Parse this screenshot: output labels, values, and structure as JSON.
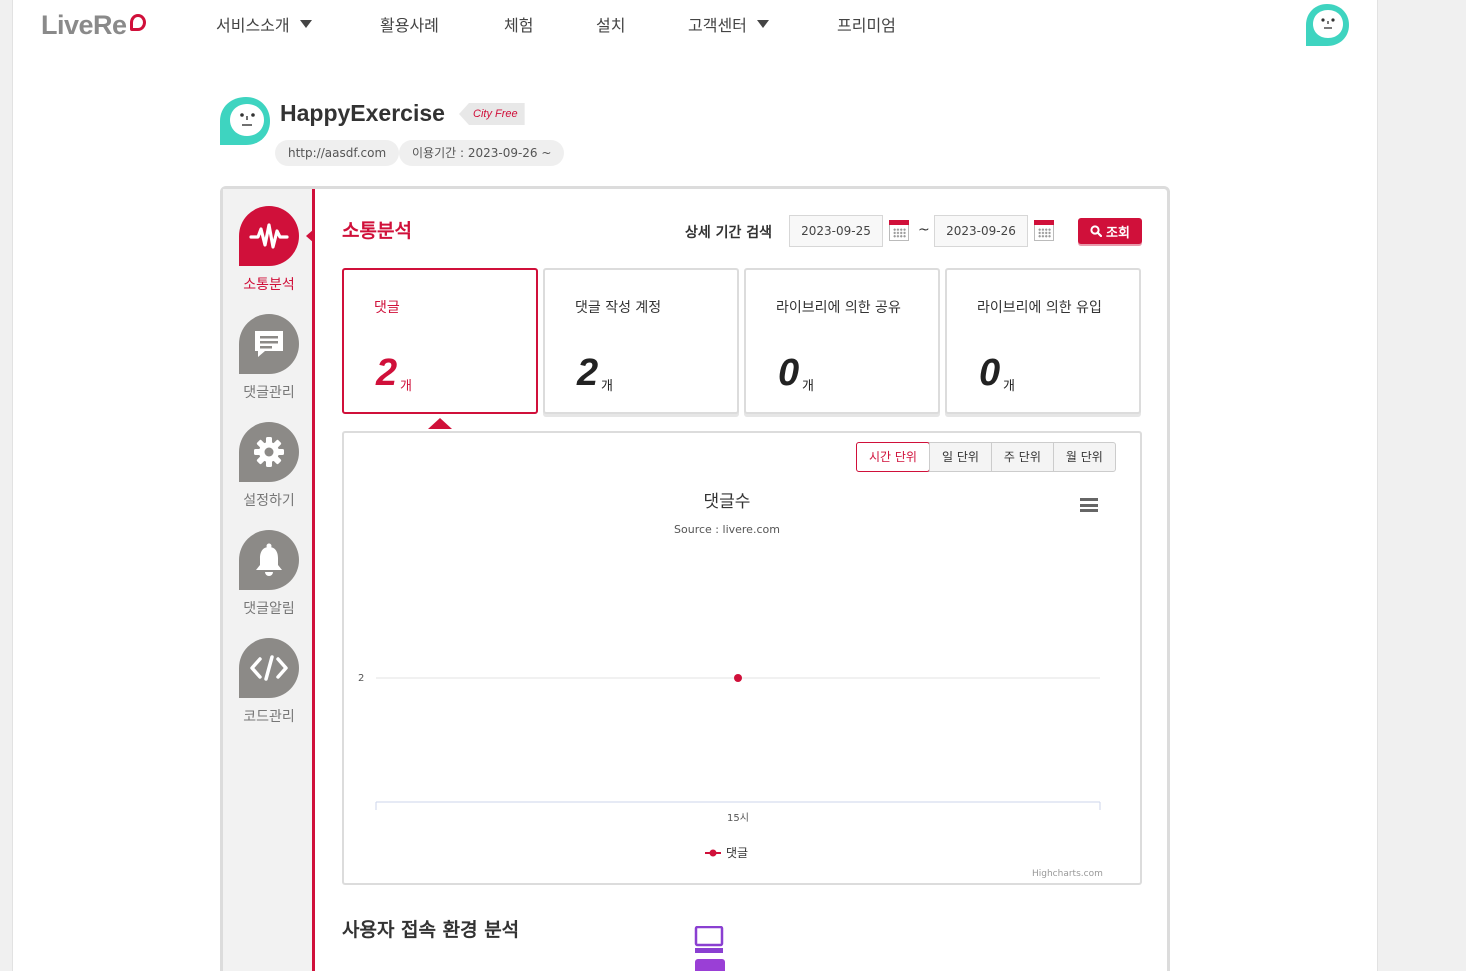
{
  "brand": {
    "logo_text": "LiveRe",
    "accent": "#d0103a",
    "mascot": "#3ed4c0"
  },
  "nav": {
    "items": [
      {
        "label": "서비스소개",
        "dropdown": true
      },
      {
        "label": "활용사례",
        "dropdown": false
      },
      {
        "label": "체험",
        "dropdown": false
      },
      {
        "label": "설치",
        "dropdown": false
      },
      {
        "label": "고객센터",
        "dropdown": true
      },
      {
        "label": "프리미엄",
        "dropdown": false
      }
    ]
  },
  "site": {
    "name": "HappyExercise",
    "plan": "City Free",
    "url": "http://aasdf.com",
    "period": "이용기간 : 2023-09-26 ~"
  },
  "sidebar": {
    "items": [
      {
        "label": "소통분석",
        "icon": "pulse-icon",
        "active": true
      },
      {
        "label": "댓글관리",
        "icon": "comment-icon",
        "active": false
      },
      {
        "label": "설정하기",
        "icon": "gear-icon",
        "active": false
      },
      {
        "label": "댓글알림",
        "icon": "bell-icon",
        "active": false
      },
      {
        "label": "코드관리",
        "icon": "code-icon",
        "active": false
      }
    ]
  },
  "analysis": {
    "title": "소통분석",
    "search_label": "상세 기간 검색",
    "date_from": "2023-09-25",
    "date_to": "2023-09-26",
    "tilde": "~",
    "query_label": "조회"
  },
  "stats": [
    {
      "label": "댓글",
      "value": "2",
      "unit": "개",
      "active": true
    },
    {
      "label": "댓글 작성 계정",
      "value": "2",
      "unit": "개",
      "active": false
    },
    {
      "label": "라이브리에 의한 공유",
      "value": "0",
      "unit": "개",
      "active": false
    },
    {
      "label": "라이브리에 의한 유입",
      "value": "0",
      "unit": "개",
      "active": false
    }
  ],
  "range_tabs": [
    {
      "label": "시간 단위",
      "active": true
    },
    {
      "label": "일 단위",
      "active": false
    },
    {
      "label": "주 단위",
      "active": false
    },
    {
      "label": "월 단위",
      "active": false
    }
  ],
  "chart_data": {
    "type": "line",
    "title": "댓글수",
    "subtitle": "Source : livere.com",
    "categories": [
      "15시"
    ],
    "series": [
      {
        "name": "댓글",
        "values": [
          2
        ],
        "color": "#d0103a"
      }
    ],
    "yticks": [
      "2"
    ],
    "credit": "Highcharts.com"
  },
  "env": {
    "title": "사용자 접속 환경 분석"
  }
}
